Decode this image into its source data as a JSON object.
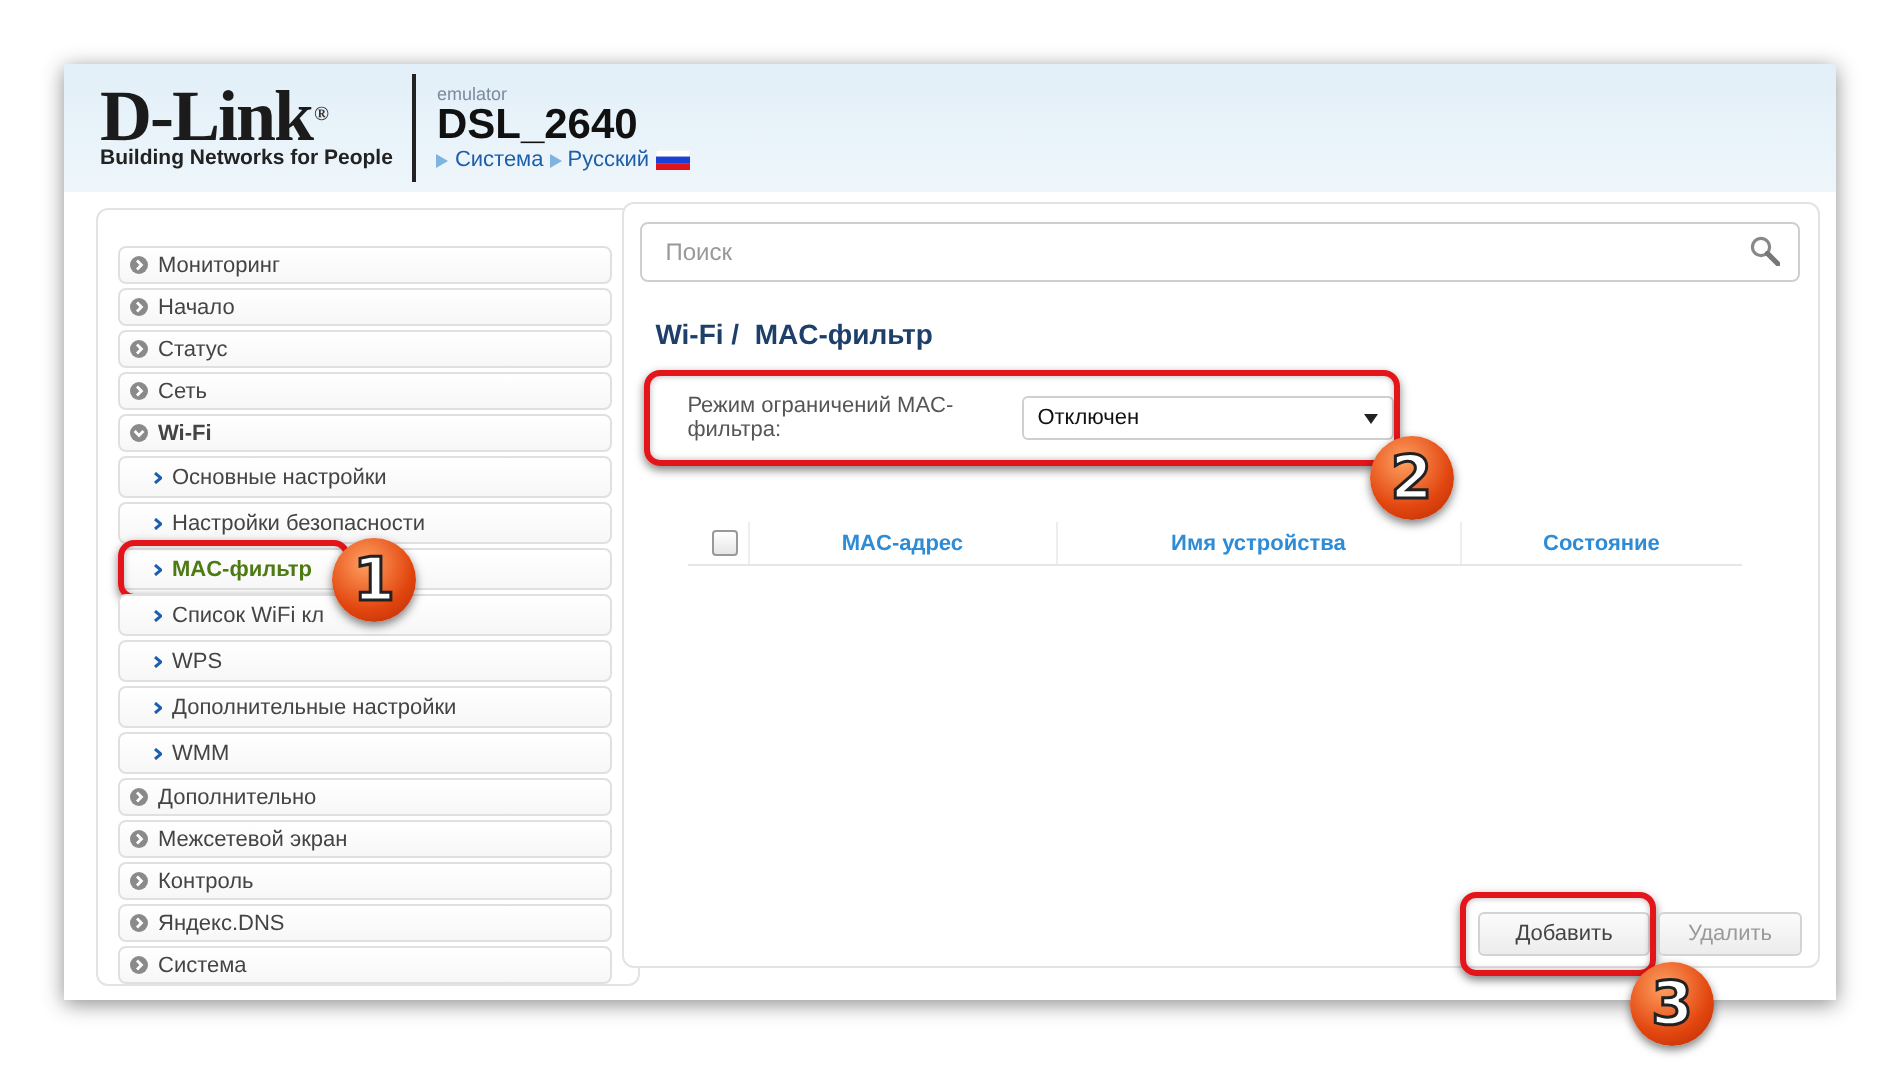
{
  "header": {
    "brand": "D-Link",
    "brand_mark": "®",
    "tagline": "Building Networks for People",
    "subtitle": "emulator",
    "model": "DSL_2640",
    "links": [
      "Система",
      "Русский"
    ]
  },
  "sidebar": {
    "items": [
      {
        "label": "Мониторинг",
        "expanded": false,
        "selected": false
      },
      {
        "label": "Начало",
        "expanded": false,
        "selected": false
      },
      {
        "label": "Статус",
        "expanded": false,
        "selected": false
      },
      {
        "label": "Сеть",
        "expanded": false,
        "selected": false
      },
      {
        "label": "Wi-Fi",
        "expanded": true,
        "selected": false,
        "children": [
          {
            "label": "Основные настройки",
            "selected": false
          },
          {
            "label": "Настройки безопасности",
            "selected": false
          },
          {
            "label": "MAC-фильтр",
            "selected": true,
            "callout": "1"
          },
          {
            "label": "Список WiFi кл",
            "selected": false
          },
          {
            "label": "WPS",
            "selected": false
          },
          {
            "label": "Дополнительные настройки",
            "selected": false
          },
          {
            "label": "WMM",
            "selected": false
          }
        ]
      },
      {
        "label": "Дополнительно",
        "expanded": false,
        "selected": false
      },
      {
        "label": "Межсетевой экран",
        "expanded": false,
        "selected": false
      },
      {
        "label": "Контроль",
        "expanded": false,
        "selected": false
      },
      {
        "label": "Яндекс.DNS",
        "expanded": false,
        "selected": false
      },
      {
        "label": "Система",
        "expanded": false,
        "selected": false
      }
    ]
  },
  "search": {
    "placeholder": "Поиск"
  },
  "page_title": "Wi-Fi /  MAC-фильтр",
  "filter_mode": {
    "label": "Режим ограничений MAC-фильтра:",
    "value": "Отключен",
    "callout": "2"
  },
  "table": {
    "select_all_checked": false,
    "columns": [
      "MAC-адрес",
      "Имя устройства",
      "Состояние"
    ]
  },
  "buttons": [
    {
      "label": "Добавить",
      "disabled": false,
      "callout": "3"
    },
    {
      "label": "Удалить",
      "disabled": true
    }
  ]
}
